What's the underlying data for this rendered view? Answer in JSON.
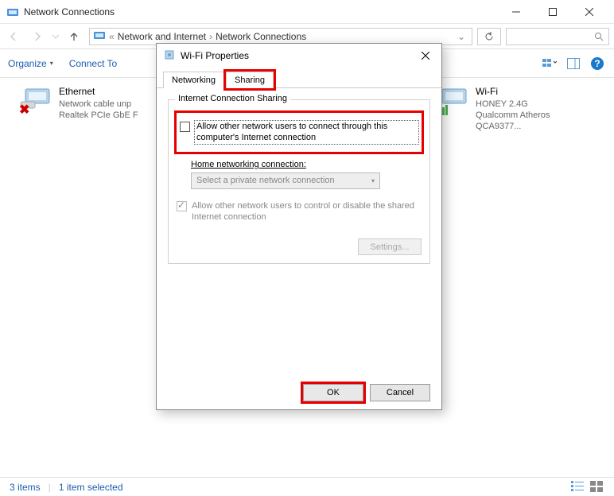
{
  "window": {
    "title": "Network Connections",
    "breadcrumb": [
      "Network and Internet",
      "Network Connections"
    ]
  },
  "toolbar": {
    "organize": "Organize",
    "connect_to": "Connect To"
  },
  "adapters": [
    {
      "name": "Ethernet",
      "status": "Network cable unp",
      "desc": "Realtek PCIe GbE F",
      "state": "disconnected"
    },
    {
      "name": "Wi-Fi",
      "status": "HONEY 2.4G",
      "desc": "Qualcomm Atheros QCA9377...",
      "state": "connected"
    }
  ],
  "statusbar": {
    "count": "3 items",
    "selected": "1 item selected"
  },
  "dialog": {
    "title": "Wi-Fi Properties",
    "tabs": {
      "networking": "Networking",
      "sharing": "Sharing"
    },
    "group_label": "Internet Connection Sharing",
    "allow_connect": "Allow other network users to connect through this computer's Internet connection",
    "home_label": "Home networking connection:",
    "dropdown_value": "Select a private network connection",
    "allow_control": "Allow other network users to control or disable the shared Internet connection",
    "settings_btn": "Settings...",
    "ok": "OK",
    "cancel": "Cancel"
  }
}
